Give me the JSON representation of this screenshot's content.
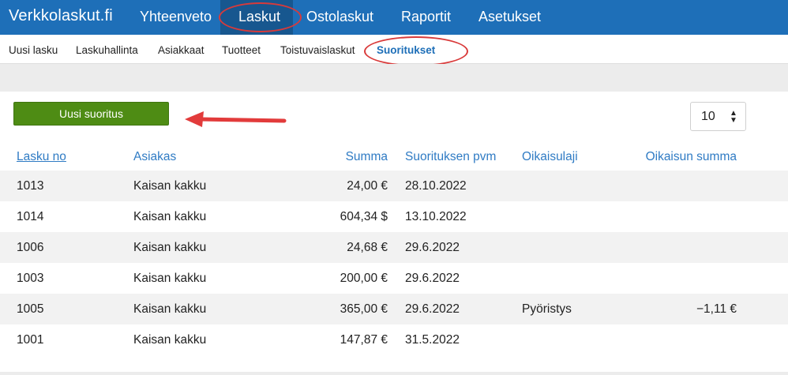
{
  "brand": "Verkkolaskut.fi",
  "top_nav": {
    "items": [
      "Yhteenveto",
      "Laskut",
      "Ostolaskut",
      "Raportit",
      "Asetukset"
    ],
    "active": "Laskut"
  },
  "sub_nav": {
    "items": [
      "Uusi lasku",
      "Laskuhallinta",
      "Asiakkaat",
      "Tuotteet",
      "Toistuvaislaskut",
      "Suoritukset"
    ],
    "active": "Suoritukset"
  },
  "toolbar": {
    "new_payment_label": "Uusi suoritus",
    "page_size": "10"
  },
  "table": {
    "columns": [
      "Lasku no",
      "Asiakas",
      "Summa",
      "Suorituksen pvm",
      "Oikaisulaji",
      "Oikaisun summa"
    ],
    "rows": [
      {
        "no": "1013",
        "customer": "Kaisan kakku",
        "amount": "24,00 €",
        "date": "28.10.2022",
        "adj_type": "",
        "adj_amount": ""
      },
      {
        "no": "1014",
        "customer": "Kaisan kakku",
        "amount": "604,34 $",
        "date": "13.10.2022",
        "adj_type": "",
        "adj_amount": ""
      },
      {
        "no": "1006",
        "customer": "Kaisan kakku",
        "amount": "24,68 €",
        "date": "29.6.2022",
        "adj_type": "",
        "adj_amount": ""
      },
      {
        "no": "1003",
        "customer": "Kaisan kakku",
        "amount": "200,00 €",
        "date": "29.6.2022",
        "adj_type": "",
        "adj_amount": ""
      },
      {
        "no": "1005",
        "customer": "Kaisan kakku",
        "amount": "365,00 €",
        "date": "29.6.2022",
        "adj_type": "Pyöristys",
        "adj_amount": "−1,11 €"
      },
      {
        "no": "1001",
        "customer": "Kaisan kakku",
        "amount": "147,87 €",
        "date": "31.5.2022",
        "adj_type": "",
        "adj_amount": ""
      }
    ]
  },
  "colors": {
    "topbar": "#1e6fb8",
    "topbar_active": "#17578f",
    "button_green": "#4e8c14",
    "link_blue": "#2f7bc4",
    "annotation_red": "#d93a3a"
  }
}
